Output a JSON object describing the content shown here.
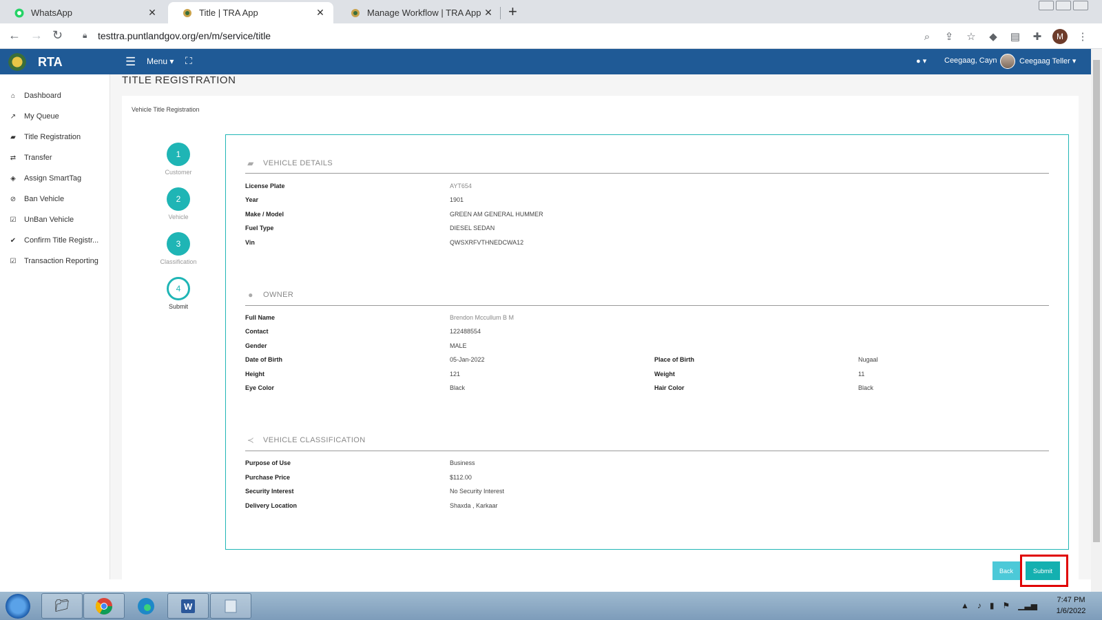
{
  "browser": {
    "tabs": [
      {
        "title": "WhatsApp",
        "icon": "whatsapp-icon",
        "active": false
      },
      {
        "title": "Title | TRA App",
        "icon": "tra-logo-icon",
        "active": true
      },
      {
        "title": "Manage Workflow | TRA App",
        "icon": "tra-logo-icon",
        "active": false
      }
    ],
    "url": "testtra.puntlandgov.org/en/m/service/title",
    "profile_initial": "M"
  },
  "header": {
    "brand": "RTA",
    "menu_label": "Menu",
    "user_name": "Ceegaag, Cayn",
    "role_name": "Ceegaag Teller",
    "color": "#1f5a96"
  },
  "sidebar": {
    "items": [
      {
        "label": "Dashboard",
        "icon": "home-icon"
      },
      {
        "label": "My Queue",
        "icon": "chart-line-icon"
      },
      {
        "label": "Title Registration",
        "icon": "car-icon"
      },
      {
        "label": "Transfer",
        "icon": "exchange-icon"
      },
      {
        "label": "Assign SmartTag",
        "icon": "tags-icon"
      },
      {
        "label": "Ban Vehicle",
        "icon": "ban-icon"
      },
      {
        "label": "UnBan Vehicle",
        "icon": "check-square-icon"
      },
      {
        "label": "Confirm Title Registr...",
        "icon": "check-icon"
      },
      {
        "label": "Transaction Reporting",
        "icon": "check-square-icon"
      }
    ]
  },
  "page": {
    "title": "TITLE REGISTRATION",
    "subtitle": "Vehicle Title Registration"
  },
  "steps": [
    {
      "number": "1",
      "label": "Customer"
    },
    {
      "number": "2",
      "label": "Vehicle"
    },
    {
      "number": "3",
      "label": "Classification"
    },
    {
      "number": "4",
      "label": "Submit"
    }
  ],
  "vehicle": {
    "heading": "VEHICLE DETAILS",
    "fields": [
      {
        "label": "License Plate",
        "value": "AYT654"
      },
      {
        "label": "Year",
        "value": "1901"
      },
      {
        "label": "Make / Model",
        "value": "GREEN AM GENERAL HUMMER"
      },
      {
        "label": "Fuel Type",
        "value": "DIESEL SEDAN"
      },
      {
        "label": "Vin",
        "value": "QWSXRFVTHNEDCWA12"
      }
    ]
  },
  "owner": {
    "heading": "OWNER",
    "full_name_label": "Full Name",
    "full_name": "Brendon Mccullum B M",
    "contact_label": "Contact",
    "contact": "122488554",
    "gender_label": "Gender",
    "gender": "MALE",
    "dob_label": "Date of Birth",
    "dob": "05-Jan-2022",
    "pob_label": "Place of Birth",
    "pob": "Nugaal",
    "height_label": "Height",
    "height": "121",
    "weight_label": "Weight",
    "weight": "11",
    "eye_label": "Eye Color",
    "eye": "Black",
    "hair_label": "Hair Color",
    "hair": "Black"
  },
  "classification": {
    "heading": "VEHICLE CLASSIFICATION",
    "fields": [
      {
        "label": "Purpose of Use",
        "value": "Business"
      },
      {
        "label": "Purchase Price",
        "value": "$112.00"
      },
      {
        "label": "Security Interest",
        "value": "No Security Interest"
      },
      {
        "label": "Delivery Location",
        "value": "Shaxda , Karkaar"
      }
    ]
  },
  "actions": {
    "back": "Back",
    "submit": "Submit"
  },
  "taskbar": {
    "apps": [
      "file-explorer-icon",
      "chrome-icon",
      "edge-icon",
      "word-icon",
      "notepad-icon"
    ],
    "time": "7:47 PM",
    "date": "1/6/2022"
  },
  "accent": "#1fb5b5"
}
